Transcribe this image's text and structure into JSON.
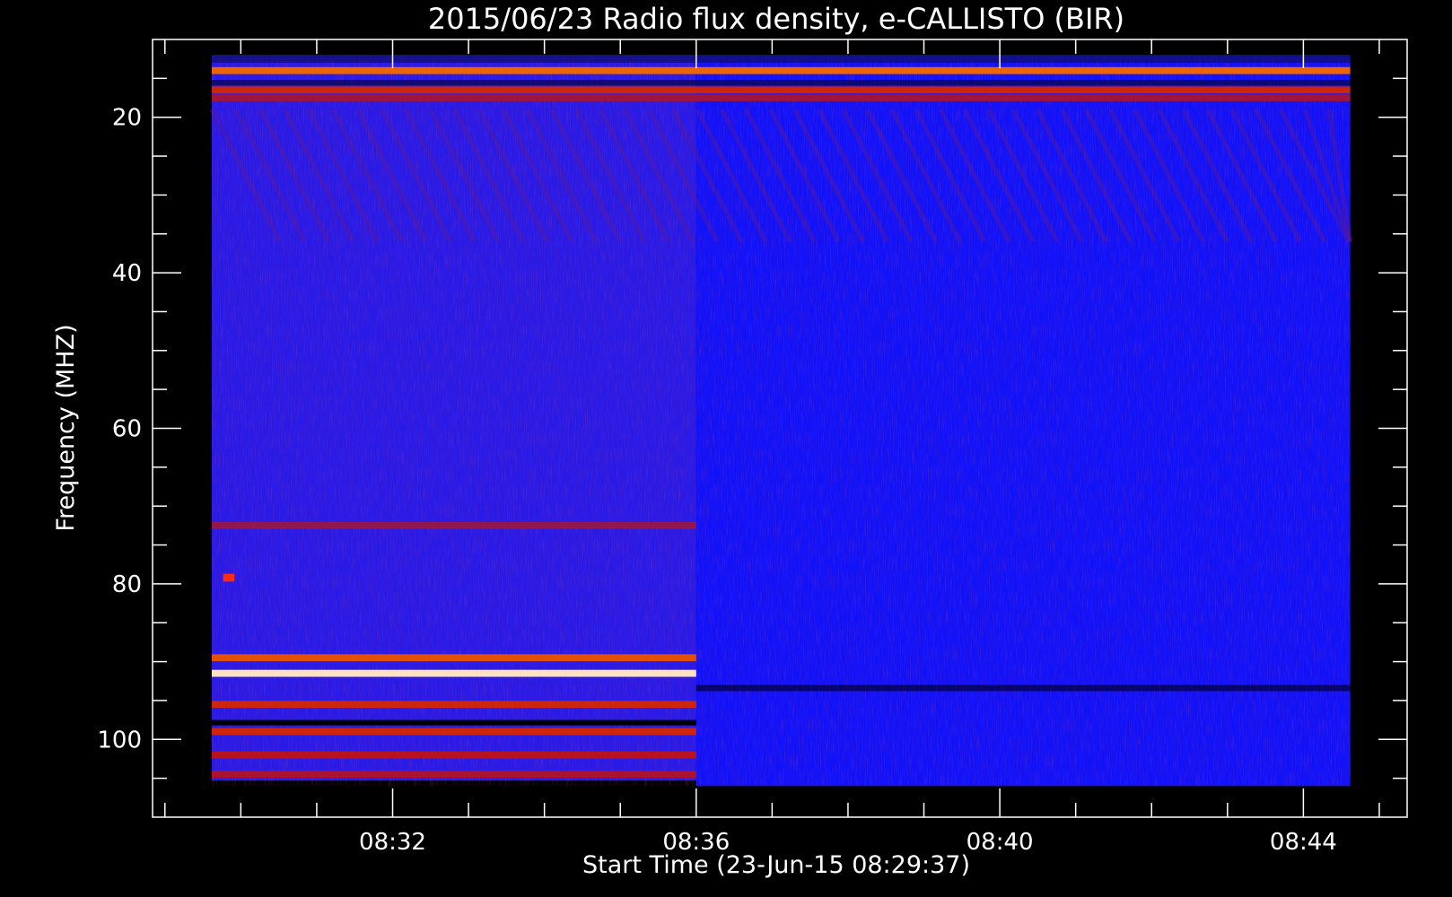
{
  "chart_data": {
    "type": "heatmap",
    "title": "2015/06/23  Radio flux density, e-CALLISTO (BIR)",
    "xlabel": "Start Time (23-Jun-15 08:29:37)",
    "ylabel": "Frequency (MHZ)",
    "x_ticks": [
      "08:32",
      "08:36",
      "08:40",
      "08:44"
    ],
    "x_tick_values_min": [
      2.383,
      6.383,
      10.383,
      14.383
    ],
    "y_ticks": [
      20,
      40,
      60,
      80,
      100
    ],
    "xlim_min": [
      -0.78,
      15.75
    ],
    "ylim": [
      10,
      110
    ],
    "data_time_range_min": [
      0,
      15
    ],
    "data_freq_range": [
      12,
      106
    ],
    "segment_break_min": 6.383,
    "colormap": [
      "#000000",
      "#0a0aff",
      "#7a1a6a",
      "#c41010",
      "#ff8a00",
      "#ffffff"
    ],
    "features": [
      {
        "freq": 91.5,
        "segment": 1,
        "intensity": 1.0
      },
      {
        "freq": 89.5,
        "segment": 1,
        "intensity": 0.65
      },
      {
        "freq": 95.5,
        "segment": 1,
        "intensity": 0.55
      },
      {
        "freq": 99,
        "segment": 1,
        "intensity": 0.55
      },
      {
        "freq": 102,
        "segment": 1,
        "intensity": 0.45
      },
      {
        "freq": 104.5,
        "segment": 1,
        "intensity": 0.4
      },
      {
        "freq": 72.5,
        "segment": 1,
        "intensity": 0.3
      },
      {
        "freq": 14,
        "segment": "all",
        "intensity": 0.7
      },
      {
        "freq": 16.5,
        "segment": "all",
        "intensity": 0.55
      },
      {
        "freq": 17.5,
        "segment": "all",
        "intensity": 0.35
      }
    ]
  }
}
